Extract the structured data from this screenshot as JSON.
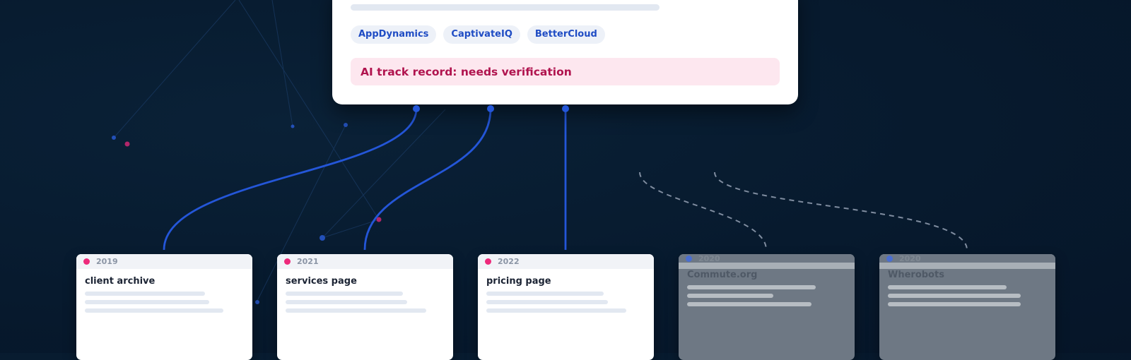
{
  "main_card": {
    "tags": [
      "AppDynamics",
      "CaptivateIQ",
      "BetterCloud"
    ],
    "alert_text": "AI track record: needs verification"
  },
  "sources": [
    {
      "year": "2019",
      "title": "client archive",
      "state": "active"
    },
    {
      "year": "2021",
      "title": "services page",
      "state": "active"
    },
    {
      "year": "2022",
      "title": "pricing page",
      "state": "active"
    },
    {
      "year": "2020",
      "title": "Commute.org",
      "state": "dimmed"
    },
    {
      "year": "2020",
      "title": "Wherobots",
      "state": "dimmed"
    }
  ],
  "colors": {
    "accent_blue": "#2456d8",
    "alert_text": "#b0134e",
    "dot_pink": "#ee2a7b",
    "dashed_connector": "#7f8c9f"
  }
}
